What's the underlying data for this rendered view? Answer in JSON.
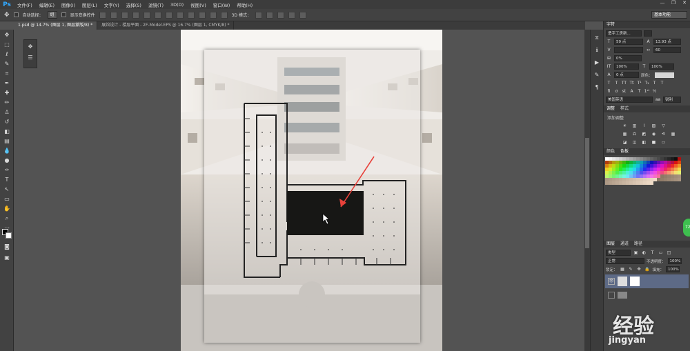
{
  "app": {
    "logo": "Ps"
  },
  "menubar": {
    "items": [
      "文件(F)",
      "编辑(E)",
      "图像(I)",
      "图层(L)",
      "文字(Y)",
      "选择(S)",
      "滤镜(T)",
      "3D(D)",
      "视图(V)",
      "窗口(W)",
      "帮助(H)"
    ],
    "win_buttons": [
      "—",
      "❐",
      "✕"
    ]
  },
  "options_bar": {
    "auto_select_label": "自动选择：",
    "auto_select_value": "组",
    "show_transform_label": "显示变换控件",
    "mode_3d_label": "3D 模式：",
    "workspace": "基本功能"
  },
  "tabs": [
    {
      "label": "1.psd @ 14.7% (图层 1, 图层蒙版/8) *",
      "active": true
    },
    {
      "label": "展馆设计 - 楼层平面 - 2F-Model.EPS @ 16.7% (图层 1, CMYK/8) *",
      "active": false
    }
  ],
  "character_panel": {
    "tab": "字符",
    "font_family": "造字工房新...",
    "font_size": "59 点",
    "leading": "13.93 点",
    "kerning": "",
    "tracking": "60",
    "scale_pct": "0%",
    "vscale": "100%",
    "hscale": "100%",
    "baseline": "0 点",
    "color_label": "颜色：",
    "language": "美国英语",
    "antialias": "锐利"
  },
  "adjust_panel": {
    "tabs": [
      "调整",
      "样式"
    ],
    "title": "添加调整"
  },
  "swatch_panel": {
    "tabs": [
      "颜色",
      "色板"
    ]
  },
  "layers_panel": {
    "tabs": [
      "图层",
      "通道",
      "路径"
    ],
    "filter": "类型",
    "blend_mode": "正常",
    "opacity_label": "不透明度：",
    "opacity": "100%",
    "lock_label": "锁定：",
    "fill_label": "填充：",
    "fill": "100%"
  },
  "watermark": {
    "line1": "经验",
    "line2": "jingyan"
  },
  "badge": {
    "text": "72"
  },
  "colors": {
    "accent": "#31a8ff",
    "panel": "#454545",
    "green": "#3ebf4f",
    "arrow": "#e8413a"
  }
}
